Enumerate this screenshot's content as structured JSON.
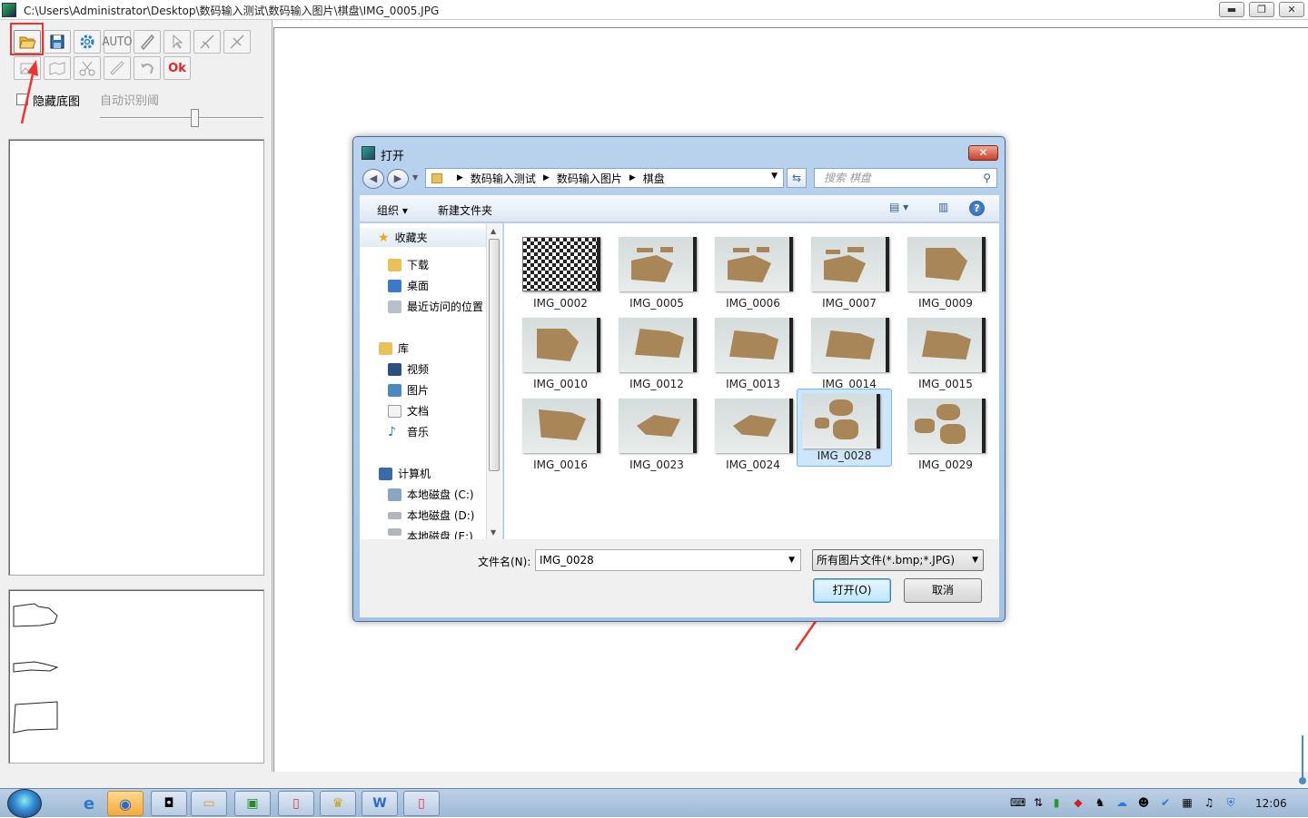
{
  "window": {
    "title": "C:\\Users\\Administrator\\Desktop\\数码输入测试\\数码输入图片\\棋盘\\IMG_0005.JPG",
    "min": "▬",
    "max": "❐",
    "close": "✕"
  },
  "toolbar": {
    "auto_label": "AUTO",
    "ok_label": "Ok"
  },
  "left": {
    "hide_bg_label": "隐藏底图",
    "auto_threshold_label": "自动识别阈"
  },
  "dialog": {
    "title": "打开",
    "close": "✕",
    "breadcrumb": [
      "数码输入测试",
      "数码输入图片",
      "棋盘"
    ],
    "search_placeholder": "搜索 棋盘",
    "organize": "组织 ▾",
    "new_folder": "新建文件夹",
    "nav": {
      "favorites": "收藏夹",
      "downloads": "下载",
      "desktop": "桌面",
      "recent": "最近访问的位置",
      "libraries": "库",
      "videos": "视频",
      "pictures": "图片",
      "documents": "文档",
      "music": "音乐",
      "computer": "计算机",
      "drive_c": "本地磁盘 (C:)",
      "drive_d": "本地磁盘 (D:)",
      "drive_e": "本地磁盘 (E:)"
    },
    "files": [
      "IMG_0002",
      "IMG_0005",
      "IMG_0006",
      "IMG_0007",
      "IMG_0009",
      "IMG_0010",
      "IMG_0012",
      "IMG_0013",
      "IMG_0014",
      "IMG_0015",
      "IMG_0016",
      "IMG_0023",
      "IMG_0024",
      "IMG_0028",
      "IMG_0029"
    ],
    "selected_file": "IMG_0028",
    "filename_label": "文件名(N):",
    "filename_value": "IMG_0028",
    "filetype_value": "所有图片文件(*.bmp;*.JPG)",
    "open_button": "打开(O)",
    "cancel_button": "取消"
  },
  "taskbar": {
    "clock": "12:06"
  },
  "colors": {
    "highlight_red": "#e33333",
    "dialog_frame": "#a5c3e6",
    "selection": "#cde6fb"
  }
}
